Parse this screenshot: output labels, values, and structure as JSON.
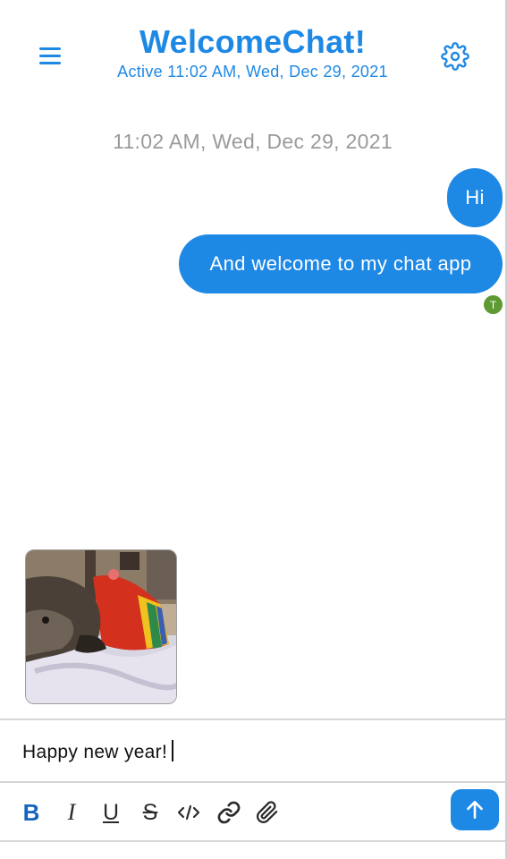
{
  "header": {
    "title": "WelcomeChat!",
    "status": "Active 11:02 AM, Wed, Dec 29, 2021",
    "menu_icon": "hamburger-menu-icon",
    "settings_icon": "gear-icon"
  },
  "conversation": {
    "date_separator": "11:02 AM, Wed, Dec 29, 2021",
    "messages": [
      {
        "text": "Hi",
        "sender": "me"
      },
      {
        "text": "And welcome to my chat app",
        "sender": "me"
      }
    ],
    "read_receipt_initial": "T",
    "attachment_preview": "dog-photo"
  },
  "composer": {
    "text": "Happy new year!",
    "toolbar": [
      "bold-icon",
      "italic-icon",
      "underline-icon",
      "strikethrough-icon",
      "code-icon",
      "link-icon",
      "paperclip-icon"
    ],
    "toolbar_labels": {
      "bold": "B",
      "italic": "I",
      "underline": "U",
      "strike": "S"
    },
    "send_icon": "arrow-up-icon"
  },
  "colors": {
    "accent": "#1e88e5",
    "bold_active": "#1565c0",
    "avatar": "#5d9a31",
    "timestamp": "#9a9a9a"
  }
}
